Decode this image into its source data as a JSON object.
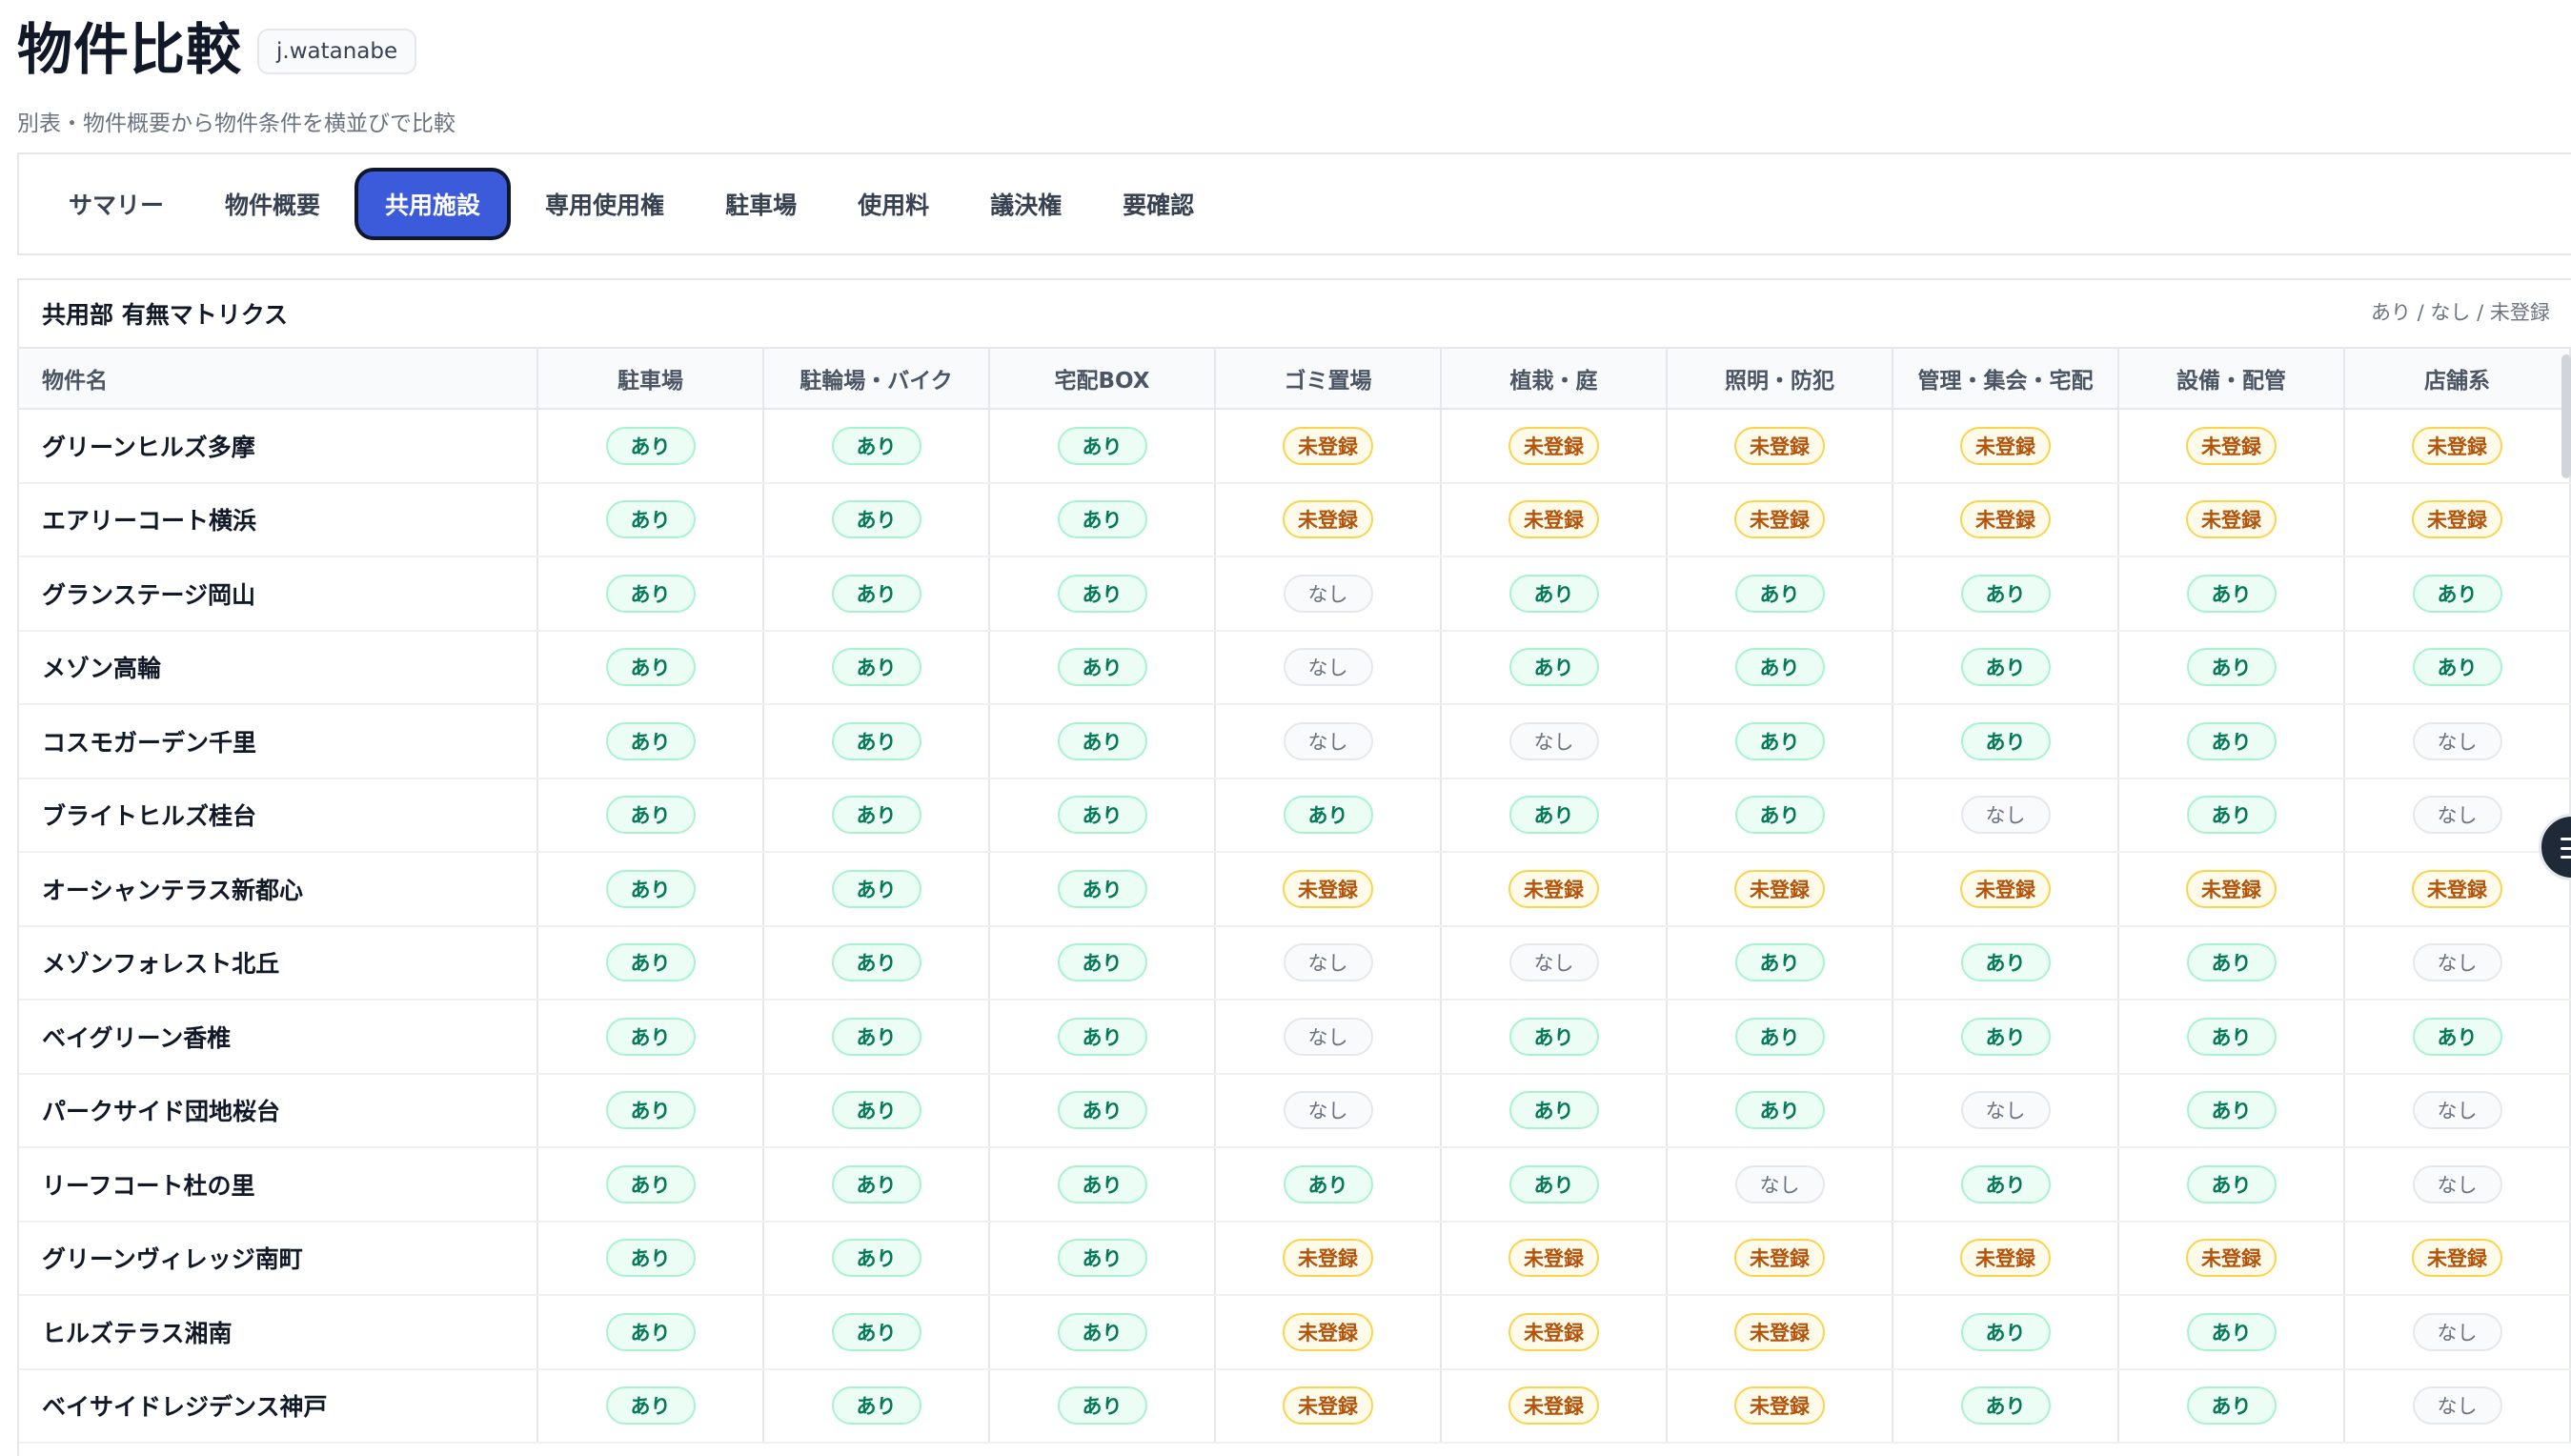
{
  "header": {
    "title": "物件比較",
    "user": "j.watanabe",
    "subtitle": "別表・物件概要から物件条件を横並びで比較"
  },
  "tabs": [
    {
      "label": "サマリー",
      "active": false
    },
    {
      "label": "物件概要",
      "active": false
    },
    {
      "label": "共用施設",
      "active": true
    },
    {
      "label": "専用使用権",
      "active": false
    },
    {
      "label": "駐車場",
      "active": false
    },
    {
      "label": "使用料",
      "active": false
    },
    {
      "label": "議決権",
      "active": false
    },
    {
      "label": "要確認",
      "active": false
    }
  ],
  "matrix": {
    "title": "共用部 有無マトリクス",
    "legend": "あり / なし / 未登録",
    "columns": [
      "物件名",
      "駐車場",
      "駐輪場・バイク",
      "宅配BOX",
      "ゴミ置場",
      "植栽・庭",
      "照明・防犯",
      "管理・集会・宅配",
      "設備・配管",
      "店舗系"
    ],
    "rows": [
      {
        "name": "グリーンヒルズ多摩",
        "values": [
          "あり",
          "あり",
          "あり",
          "未登録",
          "未登録",
          "未登録",
          "未登録",
          "未登録",
          "未登録"
        ]
      },
      {
        "name": "エアリーコート横浜",
        "values": [
          "あり",
          "あり",
          "あり",
          "未登録",
          "未登録",
          "未登録",
          "未登録",
          "未登録",
          "未登録"
        ]
      },
      {
        "name": "グランステージ岡山",
        "values": [
          "あり",
          "あり",
          "あり",
          "なし",
          "あり",
          "あり",
          "あり",
          "あり",
          "あり"
        ]
      },
      {
        "name": "メゾン高輪",
        "values": [
          "あり",
          "あり",
          "あり",
          "なし",
          "あり",
          "あり",
          "あり",
          "あり",
          "あり"
        ]
      },
      {
        "name": "コスモガーデン千里",
        "values": [
          "あり",
          "あり",
          "あり",
          "なし",
          "なし",
          "あり",
          "あり",
          "あり",
          "なし"
        ]
      },
      {
        "name": "ブライトヒルズ桂台",
        "values": [
          "あり",
          "あり",
          "あり",
          "あり",
          "あり",
          "あり",
          "なし",
          "あり",
          "なし"
        ]
      },
      {
        "name": "オーシャンテラス新都心",
        "values": [
          "あり",
          "あり",
          "あり",
          "未登録",
          "未登録",
          "未登録",
          "未登録",
          "未登録",
          "未登録"
        ]
      },
      {
        "name": "メゾンフォレスト北丘",
        "values": [
          "あり",
          "あり",
          "あり",
          "なし",
          "なし",
          "あり",
          "あり",
          "あり",
          "なし"
        ]
      },
      {
        "name": "ベイグリーン香椎",
        "values": [
          "あり",
          "あり",
          "あり",
          "なし",
          "あり",
          "あり",
          "あり",
          "あり",
          "あり"
        ]
      },
      {
        "name": "パークサイド団地桜台",
        "values": [
          "あり",
          "あり",
          "あり",
          "なし",
          "あり",
          "あり",
          "なし",
          "あり",
          "なし"
        ]
      },
      {
        "name": "リーフコート杜の里",
        "values": [
          "あり",
          "あり",
          "あり",
          "あり",
          "あり",
          "なし",
          "あり",
          "あり",
          "なし"
        ]
      },
      {
        "name": "グリーンヴィレッジ南町",
        "values": [
          "あり",
          "あり",
          "あり",
          "未登録",
          "未登録",
          "未登録",
          "未登録",
          "未登録",
          "未登録"
        ]
      },
      {
        "name": "ヒルズテラス湘南",
        "values": [
          "あり",
          "あり",
          "あり",
          "未登録",
          "未登録",
          "未登録",
          "あり",
          "あり",
          "なし"
        ]
      },
      {
        "name": "ベイサイドレジデンス神戸",
        "values": [
          "あり",
          "あり",
          "あり",
          "未登録",
          "未登録",
          "未登録",
          "あり",
          "あり",
          "なし"
        ]
      }
    ]
  },
  "colors": {
    "accent": "#3b5bdb",
    "yes": "#047857",
    "no": "#6b7280",
    "unregistered": "#b45309"
  },
  "icons": {
    "side_fab": "menu-icon"
  }
}
